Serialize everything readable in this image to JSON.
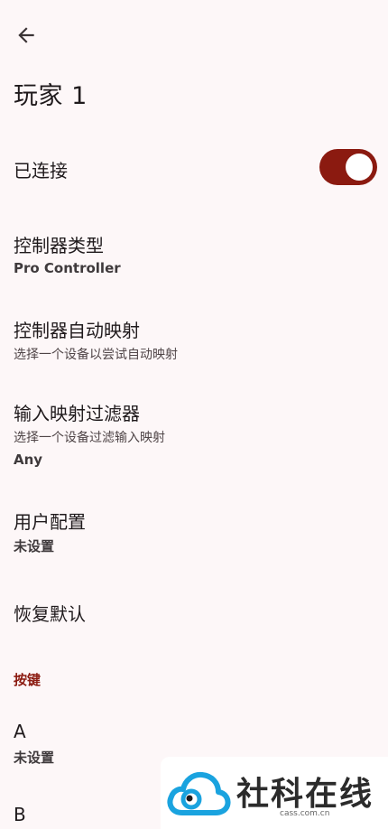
{
  "header": {
    "back_icon": "arrow-back-icon",
    "title": "玩家 1"
  },
  "connected": {
    "label": "已连接",
    "toggle_on": true,
    "accent": "#8b1a10"
  },
  "controller_type": {
    "label": "控制器类型",
    "value": "Pro Controller"
  },
  "auto_mapping": {
    "label": "控制器自动映射",
    "description": "选择一个设备以尝试自动映射"
  },
  "input_filter": {
    "label": "输入映射过滤器",
    "description": "选择一个设备过滤输入映射",
    "value": "Any"
  },
  "user_profile": {
    "label": "用户配置",
    "value": "未设置"
  },
  "restore_defaults": {
    "label": "恢复默认"
  },
  "buttons_section": {
    "title": "按键",
    "items": [
      {
        "label": "A",
        "value": "未设置"
      },
      {
        "label": "B"
      }
    ]
  },
  "watermark": {
    "text": "社科在线",
    "domain": "cass.com.cn"
  }
}
